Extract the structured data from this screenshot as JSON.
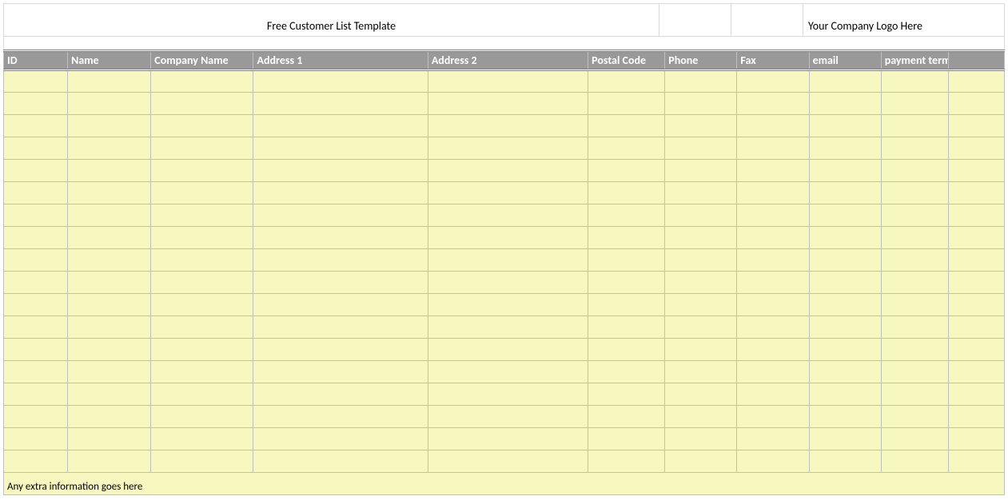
{
  "header": {
    "title": "Free Customer List Template",
    "logo_text": "Your Company Logo Here"
  },
  "columns": [
    "ID",
    "Name",
    "Company Name",
    "Address 1",
    "Address 2",
    "Postal Code",
    "Phone",
    "Fax",
    "email",
    "payment terms"
  ],
  "row_count": 18,
  "footer_text": "Any extra information goes here"
}
